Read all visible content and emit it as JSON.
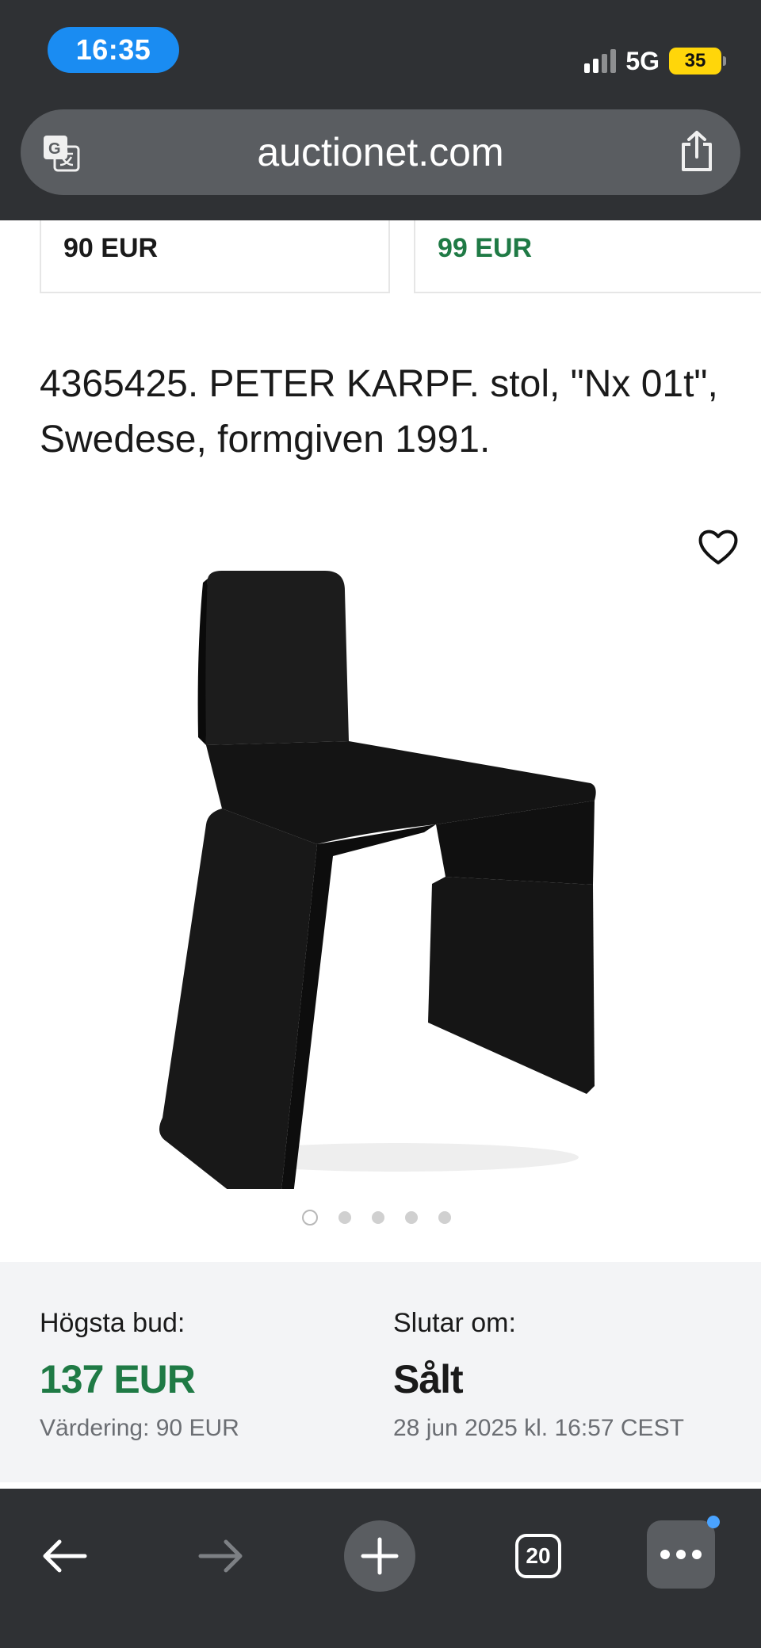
{
  "status_bar": {
    "time": "16:35",
    "network": "5G",
    "battery": "35"
  },
  "browser": {
    "url": "auctionet.com",
    "icons": [
      "translate-icon",
      "share-icon"
    ]
  },
  "prices": {
    "previous_left": "90 EUR",
    "previous_right": "99 EUR"
  },
  "item": {
    "title": "4365425. PETER KARPF. stol, \"Nx 01t\", Swedese, formgiven 1991.",
    "image_count": 5,
    "active_image": 1
  },
  "bid": {
    "highest_label": "Högsta bud:",
    "highest_value": "137 EUR",
    "estimate": "Värdering: 90 EUR",
    "ends_label": "Slutar om:",
    "ends_value": "Sålt",
    "ends_date": "28 jun 2025 kl. 16:57 CEST"
  },
  "toolbar": {
    "tabs_count": "20",
    "icons": [
      "back-arrow-icon",
      "forward-arrow-icon",
      "plus-icon",
      "tabs-icon",
      "more-icon"
    ]
  },
  "colors": {
    "chrome": "#2f3134",
    "accent_green": "#1f7a45",
    "time_pill": "#1a8cf2",
    "battery": "#ffd60a"
  }
}
